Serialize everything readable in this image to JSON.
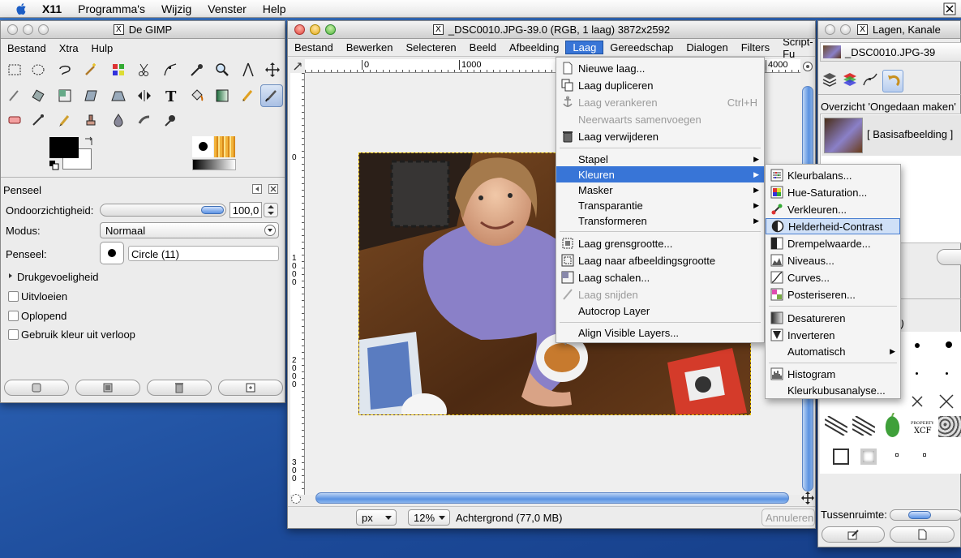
{
  "menubar": {
    "items": [
      "X11",
      "Programma's",
      "Wijzig",
      "Venster",
      "Help"
    ]
  },
  "toolbox": {
    "title": "De GIMP",
    "menu": [
      "Bestand",
      "Xtra",
      "Hulp"
    ]
  },
  "tool_options": {
    "title": "Penseel",
    "opacity_label": "Ondoorzichtigheid:",
    "opacity_value": "100,0",
    "opacity_fraction": 1.0,
    "mode_label": "Modus:",
    "mode_value": "Normaal",
    "brush_label": "Penseel:",
    "brush_value": "Circle (11)",
    "pressure_label": "Drukgevoeligheid",
    "fade_label": "Uitvloeien",
    "incremental_label": "Oplopend",
    "gradient_label": "Gebruik kleur uit verloop"
  },
  "image_window": {
    "title": "_DSC0010.JPG-39.0 (RGB, 1 laag) 3872x2592",
    "menu": [
      "Bestand",
      "Bewerken",
      "Selecteren",
      "Beeld",
      "Afbeelding",
      "Laag",
      "Gereedschap",
      "Dialogen",
      "Filters",
      "Script-Fu"
    ],
    "active_menu": "Laag",
    "ruler_h": [
      "0",
      "1000",
      "4000"
    ],
    "ruler_v": [
      "0",
      "1",
      "0",
      "0",
      "0",
      "2",
      "0",
      "0",
      "0",
      "3",
      "0",
      "0"
    ],
    "unit": "px",
    "zoom": "12%",
    "status": "Achtergrond (77,0 MB)",
    "cancel": "Annuleren"
  },
  "layer_menu": {
    "items": [
      {
        "label": "Nieuwe laag...",
        "icon": "new-layer-icon",
        "enabled": true
      },
      {
        "label": "Laag dupliceren",
        "icon": "duplicate-icon",
        "enabled": true
      },
      {
        "label": "Laag verankeren",
        "icon": "anchor-icon",
        "enabled": false,
        "accel": "Ctrl+H"
      },
      {
        "label": "Neerwaarts samenvoegen",
        "icon": "merge-down-icon",
        "enabled": false
      },
      {
        "label": "Laag verwijderen",
        "icon": "delete-icon",
        "enabled": true
      },
      {
        "label": "Stapel",
        "submenu": true,
        "enabled": true
      },
      {
        "label": "Kleuren",
        "submenu": true,
        "enabled": true,
        "highlighted": true
      },
      {
        "label": "Masker",
        "submenu": true,
        "enabled": true
      },
      {
        "label": "Transparantie",
        "submenu": true,
        "enabled": true
      },
      {
        "label": "Transformeren",
        "submenu": true,
        "enabled": true
      },
      {
        "label": "Laag grensgrootte...",
        "icon": "boundary-icon",
        "enabled": true
      },
      {
        "label": "Laag naar afbeeldingsgrootte",
        "icon": "fit-image-icon",
        "enabled": true
      },
      {
        "label": "Laag schalen...",
        "icon": "scale-icon",
        "enabled": true
      },
      {
        "label": "Laag snijden",
        "icon": "crop-icon",
        "enabled": false
      },
      {
        "label": "Autocrop Layer",
        "enabled": true
      },
      {
        "label": "Align Visible Layers...",
        "enabled": true
      }
    ]
  },
  "colors_menu": {
    "items": [
      {
        "label": "Kleurbalans...",
        "icon": "color-balance-icon"
      },
      {
        "label": "Hue-Saturation...",
        "icon": "hue-saturation-icon"
      },
      {
        "label": "Verkleuren...",
        "icon": "colorize-icon"
      },
      {
        "label": "Helderheid-Contrast",
        "icon": "brightness-contrast-icon",
        "highlighted": true
      },
      {
        "label": "Drempelwaarde...",
        "icon": "threshold-icon"
      },
      {
        "label": "Niveaus...",
        "icon": "levels-icon"
      },
      {
        "label": "Curves...",
        "icon": "curves-icon"
      },
      {
        "label": "Posteriseren...",
        "icon": "posterize-icon"
      },
      {
        "label": "Desatureren",
        "icon": "desaturate-icon"
      },
      {
        "label": "Inverteren",
        "icon": "invert-icon"
      },
      {
        "label": "Automatisch",
        "submenu": true
      },
      {
        "label": "Histogram",
        "icon": "histogram-icon"
      },
      {
        "label": "Kleurkubusanalyse..."
      }
    ]
  },
  "layers_window": {
    "title": "Lagen, Kanale",
    "image_name": "_DSC0010.JPG-39",
    "undo_label": "Overzicht 'Ongedaan maken'",
    "undo_item": "[ Basisafbeelding ]",
    "brush_fragment": "11)",
    "spacing_label": "Tussenruimte:"
  }
}
